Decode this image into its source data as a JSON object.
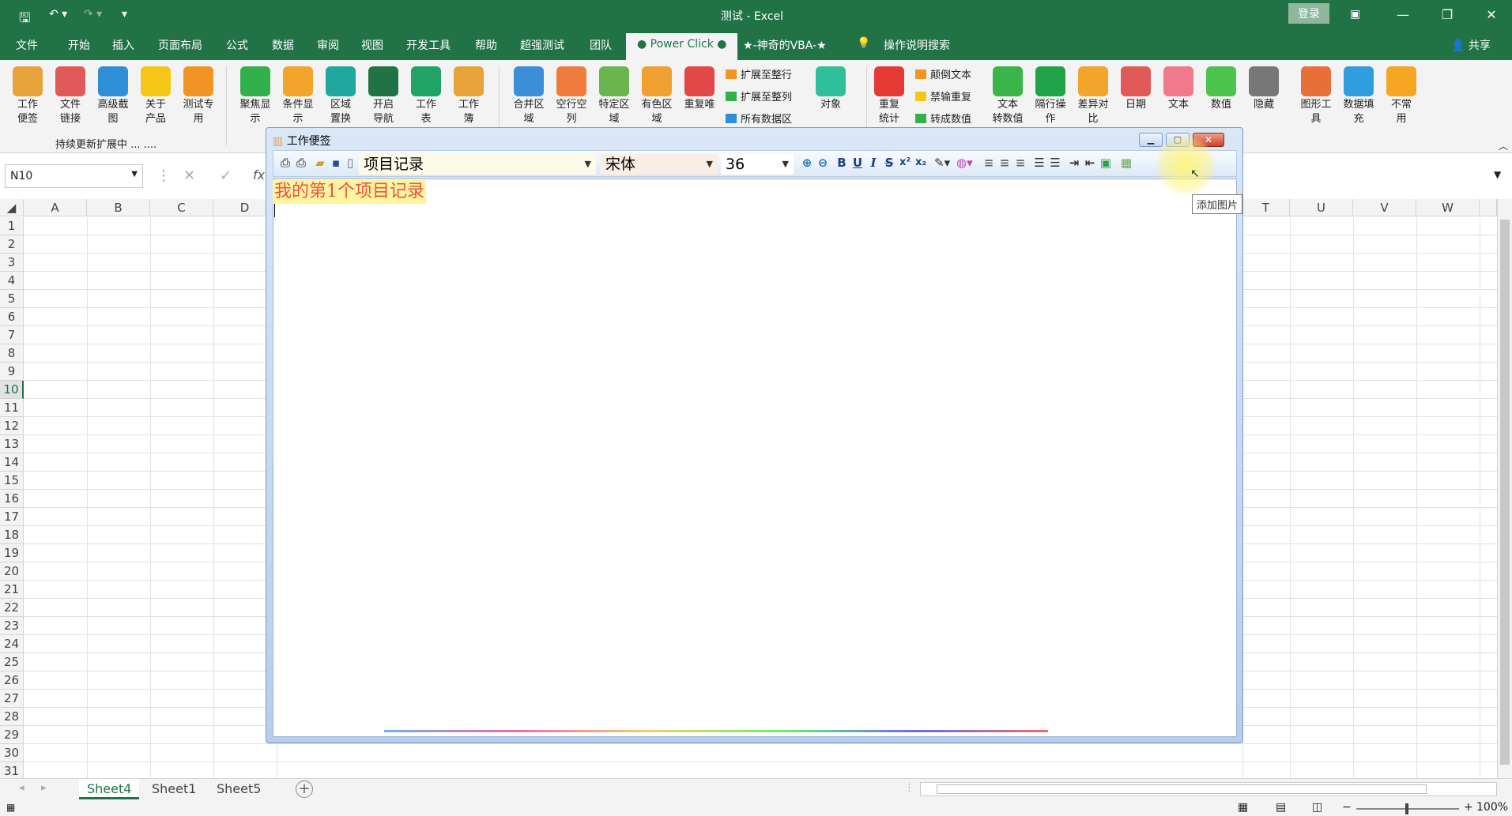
{
  "window": {
    "title": "测试  -  Excel",
    "login_label": "登录",
    "share_label": "共享"
  },
  "tabs": [
    "文件",
    "开始",
    "插入",
    "页面布局",
    "公式",
    "数据",
    "审阅",
    "视图",
    "开发工具",
    "帮助",
    "超强测试",
    "团队",
    "● Power Click ●",
    "★-神奇的VBA-★",
    "操作说明搜索"
  ],
  "ribbon": {
    "group1": [
      {
        "label": "工作\n便签",
        "color": "#e7a33a"
      },
      {
        "label": "文件\n链接",
        "color": "#e05a5a"
      },
      {
        "label": "高级截\n图",
        "color": "#2e8fd6"
      },
      {
        "label": "关于\n产品",
        "color": "#f5c518"
      },
      {
        "label": "测试专\n用",
        "color": "#f29423"
      }
    ],
    "group1_caption": "持续更新扩展中 ... ....",
    "group2": [
      {
        "label": "聚焦显\n示",
        "color": "#32b04a"
      },
      {
        "label": "条件显\n示",
        "color": "#f3a42a"
      },
      {
        "label": "区域\n置换",
        "color": "#1ea8a0"
      },
      {
        "label": "开启\n导航",
        "color": "#217346"
      },
      {
        "label": "工作\n表",
        "color": "#21a366"
      },
      {
        "label": "工作\n簿",
        "color": "#e7a33a"
      }
    ],
    "group3": [
      {
        "label": "合并区\n域",
        "color": "#3c8ed7"
      },
      {
        "label": "空行空\n列",
        "color": "#f07b3f"
      },
      {
        "label": "特定区\n域",
        "color": "#6bb54f"
      },
      {
        "label": "有色区\n域",
        "color": "#f0a030"
      },
      {
        "label": "重复唯",
        "color": "#e34848"
      }
    ],
    "group3_small": [
      {
        "label": "扩展至整行",
        "color": "#f29423"
      },
      {
        "label": "扩展至整列",
        "color": "#32b04a"
      },
      {
        "label": "所有数据区",
        "color": "#2e8fd6"
      }
    ],
    "group3_obj": {
      "label": "对象",
      "color": "#2fbf9a"
    },
    "group4": [
      {
        "label": "重复\n统计",
        "color": "#e53935"
      }
    ],
    "group4_small": [
      {
        "label": "颠倒文本",
        "color": "#f29423"
      },
      {
        "label": "禁输重复",
        "color": "#f5c518"
      },
      {
        "label": "转成数值",
        "color": "#32b04a"
      }
    ],
    "group5": [
      {
        "label": "文本\n转数值",
        "color": "#39b54a"
      },
      {
        "label": "隔行操\n作",
        "color": "#21a34a"
      },
      {
        "label": "差异对\n比",
        "color": "#f3a42a"
      },
      {
        "label": "日期",
        "color": "#e05a5a"
      },
      {
        "label": "文本",
        "color": "#f07a8a"
      },
      {
        "label": "数值",
        "color": "#4cc34c"
      },
      {
        "label": "隐藏",
        "color": "#777777"
      },
      {
        "label": "图形工\n具",
        "color": "#e7703a"
      },
      {
        "label": "数据填\n充",
        "color": "#2e9ee0"
      },
      {
        "label": "不常\n用",
        "color": "#f5a623"
      }
    ]
  },
  "formula_bar": {
    "name_box": "N10",
    "fx": "fx"
  },
  "grid": {
    "columns_left": [
      "A",
      "B",
      "C",
      "D"
    ],
    "columns_right": [
      "T",
      "U",
      "V",
      "W"
    ],
    "rows": [
      "1",
      "2",
      "3",
      "4",
      "5",
      "6",
      "7",
      "8",
      "9",
      "10",
      "11",
      "12",
      "13",
      "14",
      "15",
      "16",
      "17",
      "18",
      "19",
      "20",
      "21",
      "22",
      "23",
      "24",
      "25",
      "26",
      "27",
      "28",
      "29",
      "30",
      "31"
    ],
    "active_row": "10"
  },
  "sheets": [
    "Sheet4",
    "Sheet1",
    "Sheet5"
  ],
  "active_sheet": "Sheet4",
  "status": {
    "zoom": "100%"
  },
  "dialog": {
    "title": "工作便签",
    "record_select": "项目记录",
    "font_select": "宋体",
    "size_select": "36",
    "note_text": "我的第1个项目记录",
    "tooltip": "添加图片"
  }
}
